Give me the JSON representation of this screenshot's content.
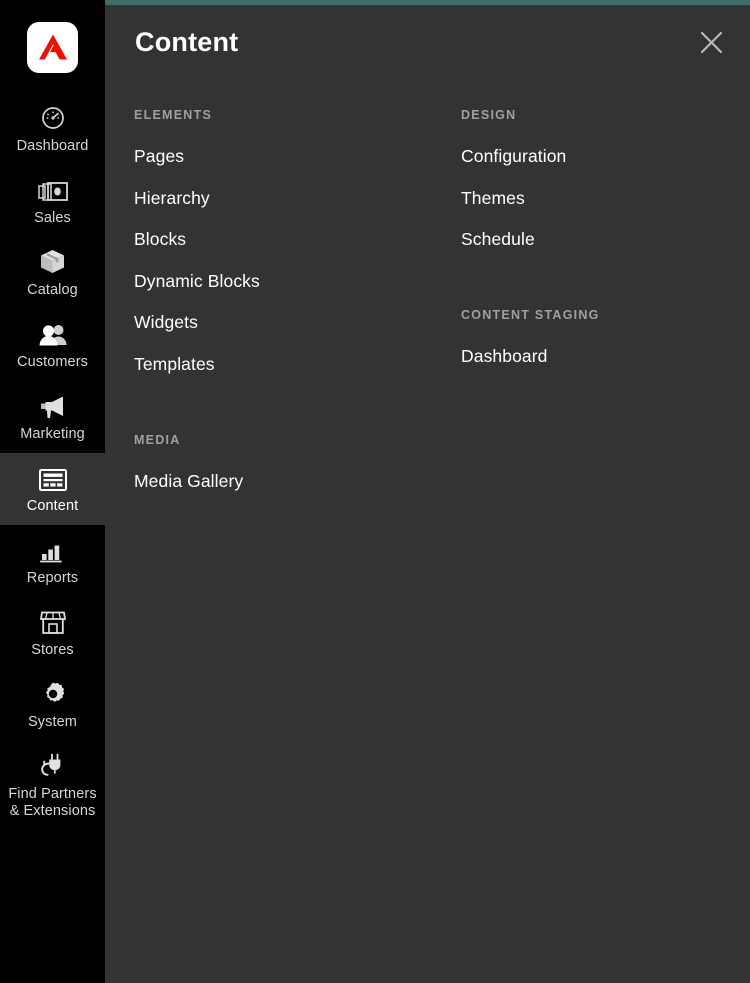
{
  "theme": {
    "sidebar_bg": "#000000",
    "panel_bg": "#333333",
    "accent_top_bar": "#3e6d6c",
    "logo_red": "#eb1000",
    "heading_gray": "#a0a0a0",
    "link_white": "#ffffff"
  },
  "sidebar": {
    "logo_name": "adobe-commerce-logo",
    "items": [
      {
        "label": "Dashboard",
        "icon": "dashboard-gauge-icon",
        "active": false
      },
      {
        "label": "Sales",
        "icon": "sales-money-icon",
        "active": false
      },
      {
        "label": "Catalog",
        "icon": "catalog-box-icon",
        "active": false
      },
      {
        "label": "Customers",
        "icon": "customers-people-icon",
        "active": false
      },
      {
        "label": "Marketing",
        "icon": "marketing-megaphone-icon",
        "active": false
      },
      {
        "label": "Content",
        "icon": "content-layout-icon",
        "active": true
      },
      {
        "label": "Reports",
        "icon": "reports-bar-chart-icon",
        "active": false
      },
      {
        "label": "Stores",
        "icon": "stores-storefront-icon",
        "active": false
      },
      {
        "label": "System",
        "icon": "system-gear-icon",
        "active": false
      },
      {
        "label": "Find Partners\n& Extensions",
        "icon": "find-partners-plug-icon",
        "active": false
      }
    ]
  },
  "panel": {
    "title": "Content",
    "close_icon": "close-x-icon",
    "columns": [
      {
        "groups": [
          {
            "title": "ELEMENTS",
            "links": [
              "Pages",
              "Hierarchy",
              "Blocks",
              "Dynamic Blocks",
              "Widgets",
              "Templates"
            ]
          },
          {
            "title": "MEDIA",
            "links": [
              "Media Gallery"
            ]
          }
        ]
      },
      {
        "groups": [
          {
            "title": "DESIGN",
            "links": [
              "Configuration",
              "Themes",
              "Schedule"
            ]
          },
          {
            "title": "CONTENT STAGING",
            "links": [
              "Dashboard"
            ]
          }
        ]
      }
    ]
  }
}
